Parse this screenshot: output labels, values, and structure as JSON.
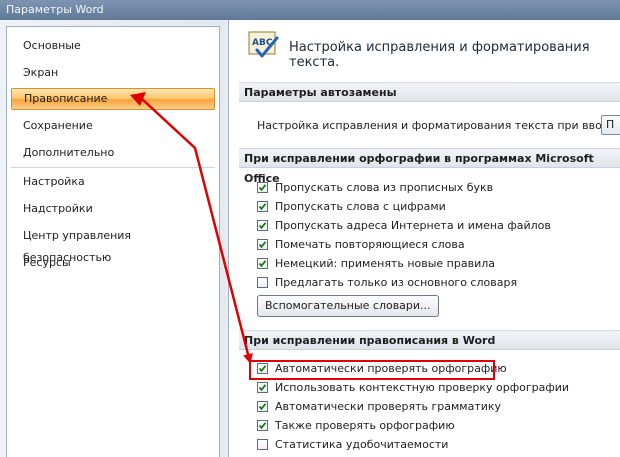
{
  "window": {
    "title": "Параметры Word"
  },
  "sidebar": {
    "items": [
      {
        "label": "Основные",
        "selected": false
      },
      {
        "label": "Экран",
        "selected": false
      },
      {
        "label": "Правописание",
        "selected": true
      },
      {
        "label": "Сохранение",
        "selected": false
      },
      {
        "label": "Дополнительно",
        "selected": false
      },
      {
        "label": "Настройка",
        "selected": false
      },
      {
        "label": "Надстройки",
        "selected": false
      },
      {
        "label": "Центр управления безопасностью",
        "selected": false
      },
      {
        "label": "Ресурсы",
        "selected": false
      }
    ]
  },
  "main": {
    "header": {
      "icon": "abc-spellcheck-icon",
      "icon_text": "ABC",
      "title": "Настройка исправления и форматирования текста."
    },
    "autocorrect": {
      "section_title": "Параметры автозамены",
      "label": "Настройка исправления и форматирования текста при вводе:",
      "button_label": "П"
    },
    "office_spelling": {
      "section_title": "При исправлении орфографии в программах Microsoft Office",
      "options": [
        {
          "label": "Пропускать слова из прописных букв",
          "checked": true
        },
        {
          "label": "Пропускать слова с цифрами",
          "checked": true
        },
        {
          "label": "Пропускать адреса Интернета и имена файлов",
          "checked": true
        },
        {
          "label": "Помечать повторяющиеся слова",
          "checked": true
        },
        {
          "label": "Немецкий: применять новые правила",
          "checked": true
        },
        {
          "label": "Предлагать только из основного словаря",
          "checked": false
        }
      ],
      "dictionaries_button": "Вспомогательные словари..."
    },
    "word_spelling": {
      "section_title": "При исправлении правописания в Word",
      "options": [
        {
          "label": "Автоматически проверять орфографию",
          "checked": true
        },
        {
          "label": "Использовать контекстную проверку орфографии",
          "checked": true
        },
        {
          "label": "Автоматически проверять грамматику",
          "checked": true
        },
        {
          "label": "Также проверять орфографию",
          "checked": true
        },
        {
          "label": "Статистика удобочитаемости",
          "checked": false
        }
      ]
    }
  },
  "colors": {
    "annotation": "#e00000",
    "selection": "#f7a43c",
    "accent_blue": "#1f4f8f"
  }
}
